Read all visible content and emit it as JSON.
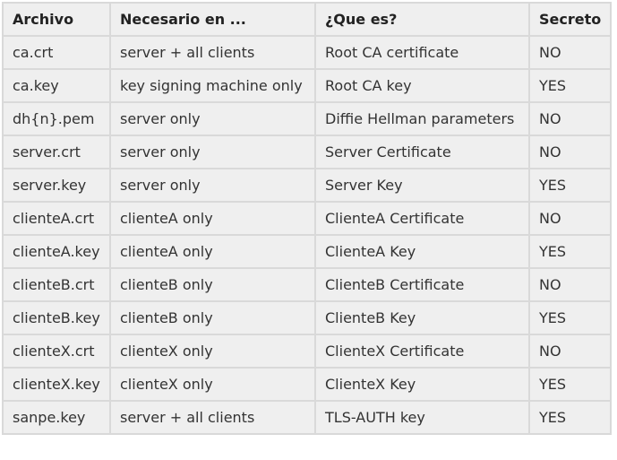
{
  "table": {
    "headers": [
      "Archivo",
      "Necesario en ...",
      "¿Que es?",
      "Secreto"
    ],
    "rows": [
      [
        "ca.crt",
        "server + all clients",
        "Root CA certificate",
        "NO"
      ],
      [
        "ca.key",
        "key signing machine only",
        "Root CA key",
        "YES"
      ],
      [
        "dh{n}.pem",
        "server only",
        "Diffie Hellman parameters",
        "NO"
      ],
      [
        "server.crt",
        "server only",
        "Server Certificate",
        "NO"
      ],
      [
        "server.key",
        "server only",
        "Server Key",
        "YES"
      ],
      [
        "clienteA.crt",
        "clienteA only",
        "ClienteA Certificate",
        "NO"
      ],
      [
        "clienteA.key",
        "clienteA only",
        "ClienteA Key",
        "YES"
      ],
      [
        "clienteB.crt",
        "clienteB only",
        "ClienteB Certificate",
        "NO"
      ],
      [
        "clienteB.key",
        "clienteB only",
        "ClienteB Key",
        "YES"
      ],
      [
        "clienteX.crt",
        "clienteX only",
        "ClienteX Certificate",
        "NO"
      ],
      [
        "clienteX.key",
        "clienteX only",
        "ClienteX Key",
        "YES"
      ],
      [
        "sanpe.key",
        "server + all clients",
        "TLS-AUTH key",
        "YES"
      ]
    ]
  }
}
